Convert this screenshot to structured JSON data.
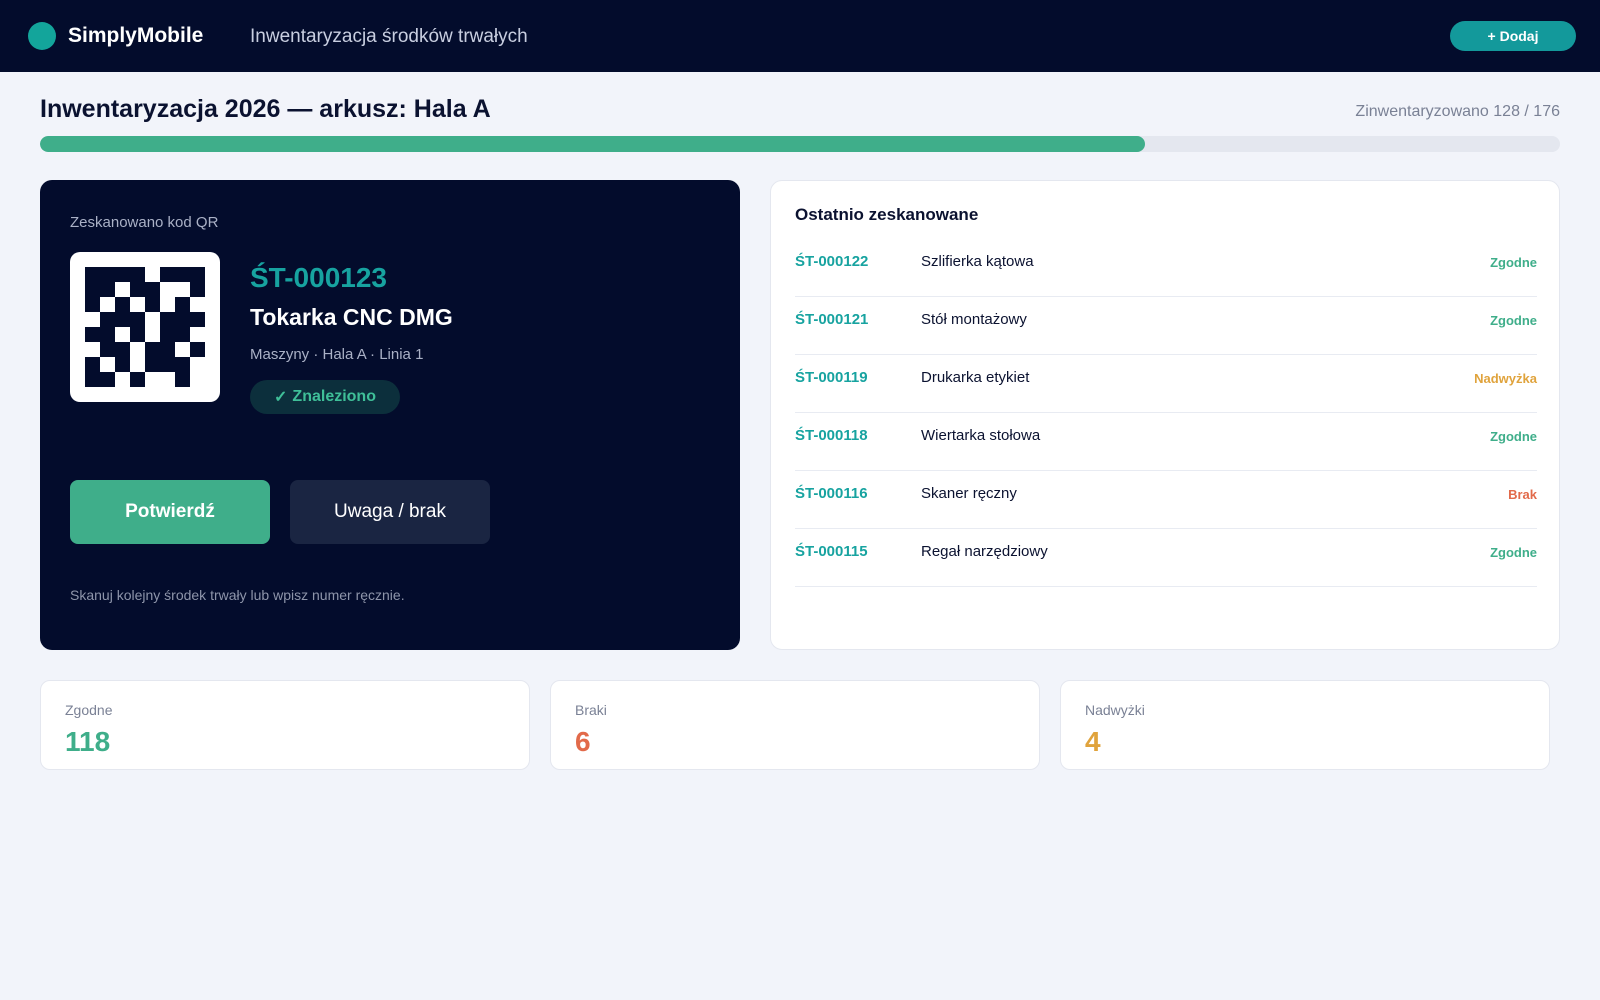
{
  "header": {
    "brand": "SimplyMobile",
    "subtitle": "Inwentaryzacja środków trwałych",
    "add_label": "+ Dodaj"
  },
  "sheet": {
    "title": "Inwentaryzacja 2026 — arkusz: Hala A",
    "progress_text": "Zinwentaryzowano 128 / 176",
    "progress_fraction": 0.727
  },
  "scan": {
    "label": "Zeskanowano kod QR",
    "asset_id": "ŚT-000123",
    "asset_name": "Tokarka CNC DMG",
    "asset_meta": "Maszyny · Hala A · Linia 1",
    "status_icon": "check-icon",
    "status_text": "Znaleziono",
    "confirm_label": "Potwierdź",
    "missing_label": "Uwaga / brak",
    "hint": "Skanuj kolejny środek trwały lub wpisz numer ręcznie."
  },
  "recent": {
    "title": "Ostatnio zeskanowane",
    "items": [
      {
        "id": "ŚT-000122",
        "name": "Szlifierka kątowa",
        "status": "Zgodne",
        "color": "#3fae8a"
      },
      {
        "id": "ŚT-000121",
        "name": "Stół montażowy",
        "status": "Zgodne",
        "color": "#3fae8a"
      },
      {
        "id": "ŚT-000119",
        "name": "Drukarka etykiet",
        "status": "Nadwyżka",
        "color": "#e0a33c"
      },
      {
        "id": "ŚT-000118",
        "name": "Wiertarka stołowa",
        "status": "Zgodne",
        "color": "#3fae8a"
      },
      {
        "id": "ŚT-000116",
        "name": "Skaner ręczny",
        "status": "Brak",
        "color": "#e26a4a"
      },
      {
        "id": "ŚT-000115",
        "name": "Regał narzędziowy",
        "status": "Zgodne",
        "color": "#3fae8a"
      }
    ]
  },
  "stats": [
    {
      "label": "Zgodne",
      "value": "118",
      "color": "#3fae8a"
    },
    {
      "label": "Braki",
      "value": "6",
      "color": "#e26a4a"
    },
    {
      "label": "Nadwyżki",
      "value": "4",
      "color": "#e0a33c"
    }
  ],
  "colors": {
    "topbar": "#030c2c",
    "accent": "#13a59b",
    "success": "#3fae8a",
    "warning": "#e0a33c",
    "danger": "#e26a4a"
  }
}
